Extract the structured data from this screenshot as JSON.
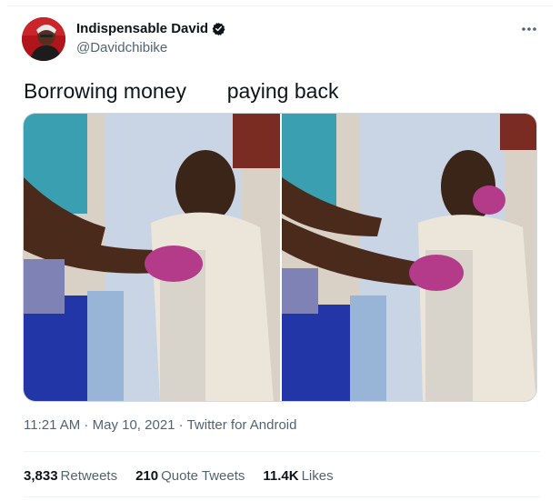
{
  "tweet": {
    "author": {
      "display_name": "Indispensable David",
      "handle": "@Davidchibike",
      "verified_icon": "verified-badge-icon",
      "avatar_color": "#b0151b"
    },
    "more_icon": "more-dots-icon",
    "text": "Borrowing money       paying back",
    "media": [
      {
        "name": "photo-left"
      },
      {
        "name": "photo-right"
      }
    ],
    "meta": {
      "time": "11:21 AM",
      "sep1": " · ",
      "date": "May 10, 2021",
      "sep2": " · ",
      "source": "Twitter for Android"
    },
    "stats": {
      "retweets_count": "3,833",
      "retweets_label": "Retweets",
      "quotes_count": "210",
      "quotes_label": "Quote Tweets",
      "likes_count": "11.4K",
      "likes_label": "Likes"
    },
    "colors": {
      "accent": "#1d9bf0",
      "text": "#0f1419",
      "secondary": "#536471"
    }
  }
}
